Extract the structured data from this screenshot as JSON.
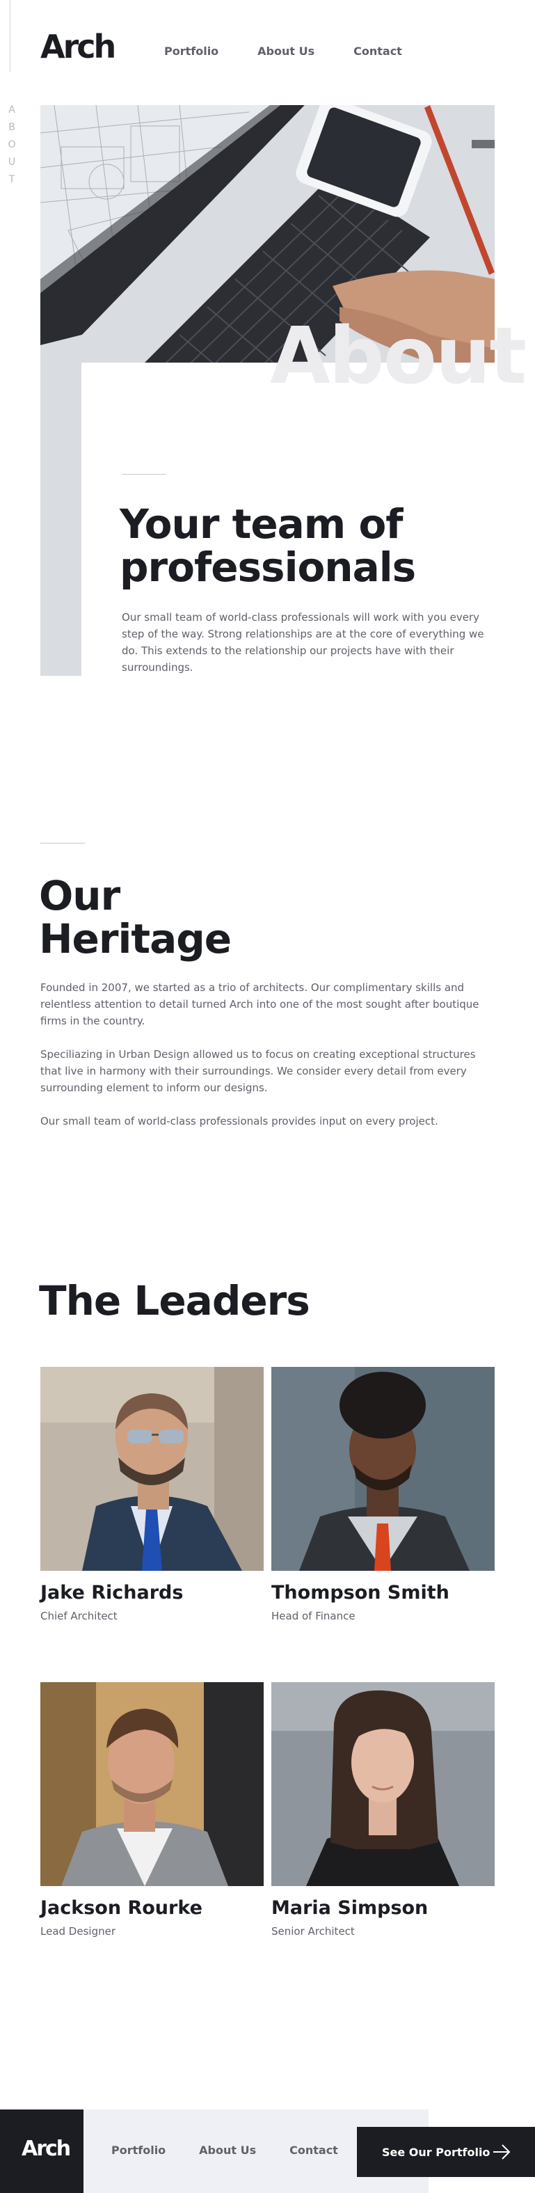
{
  "header": {
    "logo": "Arch",
    "nav": [
      "Portfolio",
      "About Us",
      "Contact"
    ]
  },
  "hero": {
    "vertical_label": "ABOUT",
    "watermark": "About",
    "title": "Your team of professionals",
    "text": "Our small team of world-class professionals will work with you every step of the way. Strong relationships are at the core of everything we do. This extends to the relationship our projects have with their surroundings."
  },
  "heritage": {
    "title": "Our Heritage",
    "paragraphs": [
      "Founded in 2007, we started as a trio of architects. Our complimentary skills and relentless attention to detail turned Arch into one of the most sought after boutique firms in the country.",
      "Speciliazing in Urban Design allowed us to focus on creating exceptional structures that live in harmony with their surroundings. We consider every detail from every surrounding element to inform our designs.",
      "Our small team of world-class professionals provides input on every project."
    ]
  },
  "leaders": {
    "title": "The Leaders",
    "people": [
      {
        "name": "Jake Richards",
        "role": "Chief Architect"
      },
      {
        "name": "Thompson Smith",
        "role": "Head of Finance"
      },
      {
        "name": "Jackson Rourke",
        "role": "Lead Designer"
      },
      {
        "name": "Maria Simpson",
        "role": "Senior Architect"
      }
    ]
  },
  "footer": {
    "logo": "Arch",
    "nav": [
      "Portfolio",
      "About Us",
      "Contact"
    ],
    "cta_label": "See Our Portfolio",
    "cta_icon": "arrow-right-icon"
  },
  "colors": {
    "primary_dark": "#1b1d23",
    "text_gray": "#5f616a",
    "footer_bg": "#eef0f5",
    "watermark": "#ececef"
  }
}
